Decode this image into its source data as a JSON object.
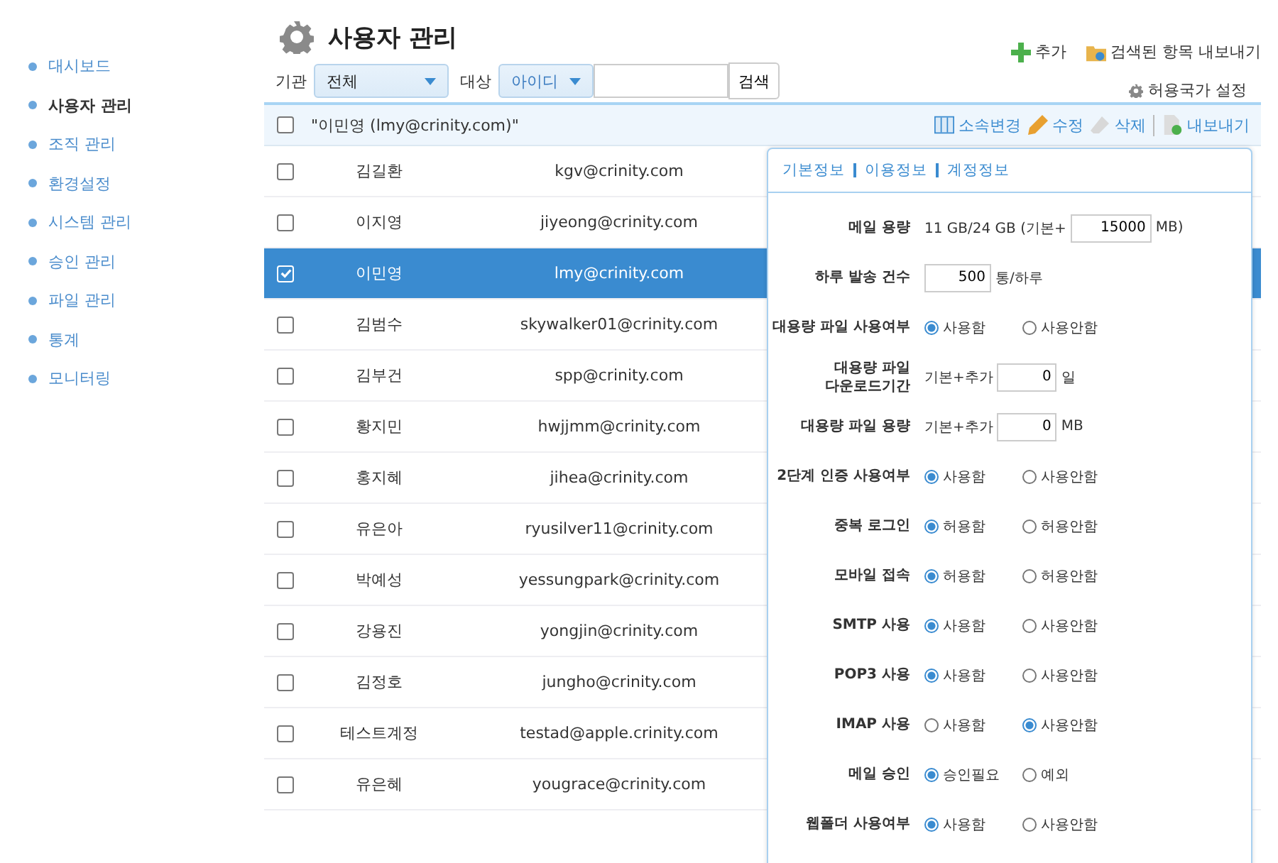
{
  "sidebar": {
    "items": [
      {
        "label": "대시보드",
        "selected": false
      },
      {
        "label": "사용자 관리",
        "selected": true
      },
      {
        "label": "조직 관리",
        "selected": false
      },
      {
        "label": "환경설정",
        "selected": false
      },
      {
        "label": "시스템 관리",
        "selected": false
      },
      {
        "label": "승인 관리",
        "selected": false
      },
      {
        "label": "파일 관리",
        "selected": false
      },
      {
        "label": "통계",
        "selected": false
      },
      {
        "label": "모니터링",
        "selected": false
      }
    ]
  },
  "page_title": "사용자 관리",
  "actions": [
    {
      "kind": "add",
      "label": "추가"
    },
    {
      "kind": "export",
      "label": "검색된 항목 내보내기"
    }
  ],
  "filters": {
    "org_label": "기관",
    "org_value": "전체",
    "target_label": "대상",
    "target_value": "아이디",
    "search_button": "검색",
    "country_setting": "허용국가 설정"
  },
  "table": {
    "header": {
      "checked": false,
      "title": "\"이민영 (lmy@crinity.com)\"",
      "tools": [
        {
          "kind": "move",
          "label": "소속변경"
        },
        {
          "kind": "edit",
          "label": "수정"
        },
        {
          "kind": "delete",
          "label": "삭제"
        },
        {
          "kind": "export",
          "label": "내보내기"
        }
      ]
    },
    "rows": [
      {
        "name": "김길환",
        "email": "kgv@crinity.com",
        "selected": false
      },
      {
        "name": "이지영",
        "email": "jiyeong@crinity.com",
        "selected": false
      },
      {
        "name": "이민영",
        "email": "lmy@crinity.com",
        "selected": true
      },
      {
        "name": "김범수",
        "email": "skywalker01@crinity.com",
        "selected": false
      },
      {
        "name": "김부건",
        "email": "spp@crinity.com",
        "selected": false
      },
      {
        "name": "황지민",
        "email": "hwjjmm@crinity.com",
        "selected": false
      },
      {
        "name": "홍지혜",
        "email": "jihea@crinity.com",
        "selected": false
      },
      {
        "name": "유은아",
        "email": "ryusilver11@crinity.com",
        "selected": false
      },
      {
        "name": "박예성",
        "email": "yessungpark@crinity.com",
        "selected": false
      },
      {
        "name": "강용진",
        "email": "yongjin@crinity.com",
        "selected": false
      },
      {
        "name": "김정호",
        "email": "jungho@crinity.com",
        "selected": false
      },
      {
        "name": "테스트계정",
        "email": "testad@apple.crinity.com",
        "selected": false
      },
      {
        "name": "유은혜",
        "email": "yougrace@crinity.com",
        "selected": false
      }
    ]
  },
  "detail_panel": {
    "tabs": [
      "기본정보",
      "이용정보",
      "계정정보"
    ],
    "rows": [
      {
        "label": "메일 용량",
        "parts": [
          {
            "kind": "text",
            "text": "11 GB/24 GB (기본+"
          },
          {
            "kind": "input",
            "value": "15000"
          },
          {
            "kind": "text",
            "text": "MB)"
          }
        ]
      },
      {
        "label": "하루 발송 건수",
        "parts": [
          {
            "kind": "input",
            "value": "500"
          },
          {
            "kind": "text",
            "text": "통/하루"
          }
        ]
      },
      {
        "label": "대용량 파일 사용여부",
        "parts": [
          {
            "kind": "radio",
            "text": "사용함",
            "selected": true
          },
          {
            "kind": "radio",
            "text": "사용안함",
            "selected": false
          }
        ]
      },
      {
        "label": "대용량 파일 다운로드기간",
        "parts": [
          {
            "kind": "text",
            "text": "기본+추가"
          },
          {
            "kind": "input",
            "value": "0"
          },
          {
            "kind": "text",
            "text": "일"
          }
        ]
      },
      {
        "label": "대용량 파일 용량",
        "parts": [
          {
            "kind": "text",
            "text": "기본+추가"
          },
          {
            "kind": "input",
            "value": "0"
          },
          {
            "kind": "text",
            "text": "MB"
          }
        ]
      },
      {
        "label": "2단계 인증 사용여부",
        "parts": [
          {
            "kind": "radio",
            "text": "사용함",
            "selected": true
          },
          {
            "kind": "radio",
            "text": "사용안함",
            "selected": false
          }
        ]
      },
      {
        "label": "중복 로그인",
        "parts": [
          {
            "kind": "radio",
            "text": "허용함",
            "selected": true
          },
          {
            "kind": "radio",
            "text": "허용안함",
            "selected": false
          }
        ]
      },
      {
        "label": "모바일 접속",
        "parts": [
          {
            "kind": "radio",
            "text": "허용함",
            "selected": true
          },
          {
            "kind": "radio",
            "text": "허용안함",
            "selected": false
          }
        ]
      },
      {
        "label": "SMTP 사용",
        "parts": [
          {
            "kind": "radio",
            "text": "사용함",
            "selected": true
          },
          {
            "kind": "radio",
            "text": "사용안함",
            "selected": false
          }
        ]
      },
      {
        "label": "POP3 사용",
        "parts": [
          {
            "kind": "radio",
            "text": "사용함",
            "selected": true
          },
          {
            "kind": "radio",
            "text": "사용안함",
            "selected": false
          }
        ]
      },
      {
        "label": "IMAP 사용",
        "parts": [
          {
            "kind": "radio",
            "text": "사용함",
            "selected": false
          },
          {
            "kind": "radio",
            "text": "사용안함",
            "selected": true
          }
        ]
      },
      {
        "label": "메일 승인",
        "parts": [
          {
            "kind": "radio",
            "text": "승인필요",
            "selected": true
          },
          {
            "kind": "radio",
            "text": "예외",
            "selected": false
          }
        ]
      },
      {
        "label": "웹폴더 사용여부",
        "parts": [
          {
            "kind": "radio",
            "text": "사용함",
            "selected": true
          },
          {
            "kind": "radio",
            "text": "사용안함",
            "selected": false
          }
        ]
      }
    ]
  }
}
